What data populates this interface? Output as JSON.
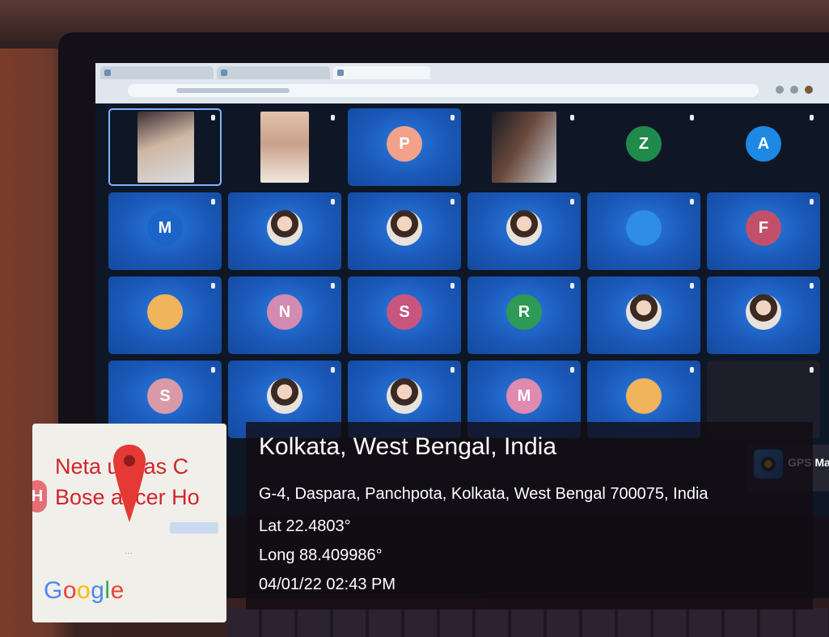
{
  "meeting": {
    "participants": [
      {
        "name": "",
        "avatar": "",
        "kind": "video"
      },
      {
        "name": "",
        "avatar": "",
        "kind": "video"
      },
      {
        "name": "",
        "avatar": "P",
        "color": "#f2a28a"
      },
      {
        "name": "",
        "avatar": "",
        "kind": "video"
      },
      {
        "name": "",
        "avatar": "Z",
        "color": "#1f8a4c",
        "dark": true
      },
      {
        "name": "",
        "avatar": "A",
        "color": "#1e88e5",
        "dark": true
      },
      {
        "name": "",
        "avatar": "M",
        "color": "#1d64c8"
      },
      {
        "name": "",
        "avatar": "",
        "kind": "photo"
      },
      {
        "name": "",
        "avatar": "",
        "kind": "photo"
      },
      {
        "name": "",
        "avatar": "",
        "kind": "photo"
      },
      {
        "name": "",
        "avatar": "",
        "color": "#2f8ce8"
      },
      {
        "name": "",
        "avatar": "F",
        "color": "#c2506a"
      },
      {
        "name": "",
        "avatar": "",
        "color": "#f0b45c"
      },
      {
        "name": "",
        "avatar": "N",
        "color": "#d48bb2"
      },
      {
        "name": "",
        "avatar": "S",
        "color": "#c8557e"
      },
      {
        "name": "",
        "avatar": "R",
        "color": "#2e9a55"
      },
      {
        "name": "",
        "avatar": "",
        "kind": "photo"
      },
      {
        "name": "",
        "avatar": "",
        "kind": "photo"
      },
      {
        "name": "",
        "avatar": "S",
        "color": "#d89aa6"
      },
      {
        "name": "",
        "avatar": "",
        "kind": "photo"
      },
      {
        "name": "",
        "avatar": "",
        "kind": "photo"
      },
      {
        "name": "",
        "avatar": "M",
        "color": "#e08ab0"
      },
      {
        "name": "",
        "avatar": "",
        "color": "#f0b45c"
      },
      {
        "name": "",
        "avatar": "",
        "kind": "peek"
      }
    ]
  },
  "gps_app": {
    "name": "GPS Map Camera",
    "icon": "camera-lens-icon"
  },
  "location": {
    "title": "Kolkata, West Bengal, India",
    "address": "G-4, Daspara, Panchpota, Kolkata, West Bengal 700075, India",
    "latitude": "Lat 22.4803°",
    "longitude": "Long 88.409986°",
    "datetime": "04/01/22 02:43 PM"
  },
  "map_thumbnail": {
    "place_line1": "Neta   ubhas C",
    "place_line2": "Bose   ancer Ho",
    "badge": "H",
    "dots": "...",
    "logo": [
      "G",
      "o",
      "o",
      "g",
      "l",
      "e"
    ],
    "pin_icon": "map-pin-icon",
    "pin_color": "#e53935"
  }
}
